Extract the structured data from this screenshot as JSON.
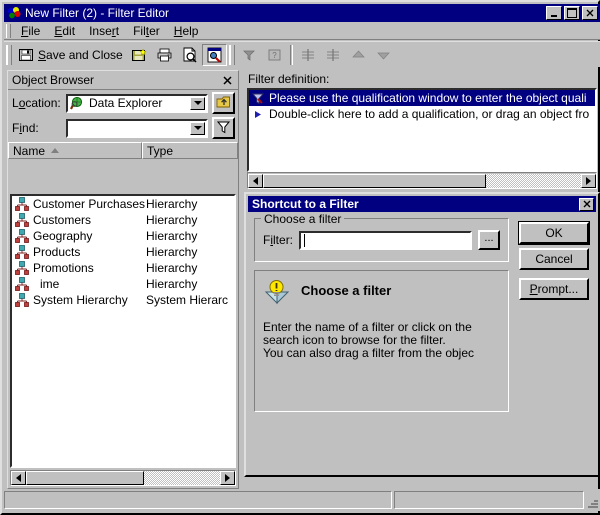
{
  "window": {
    "title": "New Filter (2) - Filter Editor",
    "app_icon": "spheres-icon",
    "minimize_label": "_",
    "maximize_label": "□",
    "close_label": "✕"
  },
  "menu": {
    "items": [
      {
        "label": "File",
        "mnemonic": "F"
      },
      {
        "label": "Edit",
        "mnemonic": "E"
      },
      {
        "label": "Insert",
        "mnemonic": "r"
      },
      {
        "label": "Filter",
        "mnemonic": "t"
      },
      {
        "label": "Help",
        "mnemonic": "H"
      }
    ]
  },
  "toolbar": {
    "save_and_close_label": "Save and Close",
    "buttons": [
      {
        "name": "save-and-close",
        "icon": "floppy-disk-icon",
        "enabled": true
      },
      {
        "name": "save-as",
        "icon": "floppy-disk-star-icon",
        "enabled": true
      },
      {
        "name": "print",
        "icon": "printer-icon",
        "enabled": true
      },
      {
        "name": "print-preview",
        "icon": "document-magnifier-icon",
        "enabled": true
      },
      {
        "name": "find",
        "icon": "window-search-icon",
        "enabled": true,
        "pressed": true
      },
      {
        "name": "insert-shortcut-filter",
        "icon": "filter-shortcut-icon",
        "enabled": false
      },
      {
        "name": "insert-prompt",
        "icon": "prompt-icon",
        "enabled": false
      },
      {
        "name": "insert-qualification",
        "icon": "qualification-icon",
        "enabled": false
      },
      {
        "name": "insert-qualification-2",
        "icon": "qualification-icon",
        "enabled": false
      },
      {
        "name": "move-up",
        "icon": "arrow-up-icon",
        "enabled": false
      },
      {
        "name": "move-down",
        "icon": "arrow-down-icon",
        "enabled": false
      }
    ]
  },
  "object_browser": {
    "title": "Object Browser",
    "close_label": "✕",
    "location_label": "Location:",
    "location_value": "Data Explorer",
    "location_icon": "data-explorer-icon",
    "up_button_icon": "up-one-level-icon",
    "find_label": "Find:",
    "find_value": "",
    "filter_button_icon": "funnel-icon",
    "columns": [
      "Name",
      "Type"
    ],
    "sort_column": "Name",
    "sort_direction": "ascending",
    "items": [
      {
        "name": "Customer Purchases",
        "type": "Hierarchy",
        "icon": "hierarchy-icon"
      },
      {
        "name": "Customers",
        "type": "Hierarchy",
        "icon": "hierarchy-icon"
      },
      {
        "name": "Geography",
        "type": "Hierarchy",
        "icon": "hierarchy-icon"
      },
      {
        "name": "Products",
        "type": "Hierarchy",
        "icon": "hierarchy-icon"
      },
      {
        "name": "Promotions",
        "type": "Hierarchy",
        "icon": "hierarchy-icon"
      },
      {
        "name": "ime",
        "type": "Hierarchy",
        "icon": "hierarchy-icon"
      },
      {
        "name": "System Hierarchy",
        "type": "System Hierarc",
        "icon": "hierarchy-icon"
      }
    ],
    "scroll_left_label": "◀",
    "scroll_right_label": "▶"
  },
  "filter_definition": {
    "label": "Filter definition:",
    "rows": [
      {
        "text": "Please use the qualification window to enter the object quali",
        "icon": "filter-icon",
        "selected": true
      },
      {
        "text": "Double-click here to add a qualification, or drag an object fro",
        "icon": "blue-triangle-bullet-icon",
        "selected": false
      }
    ],
    "scroll_left_label": "◀",
    "scroll_right_label": "▶"
  },
  "dialog": {
    "title": "Shortcut to a Filter",
    "close_label": "✕",
    "group_legend": "Choose a filter",
    "filter_label": "Filter:",
    "filter_value": "",
    "filter_placeholder": "",
    "browse_label": "...",
    "help": {
      "icon": "lightbulb-tip-icon",
      "title": "Choose a filter",
      "lines": [
        "Enter the name of a filter or click on the",
        "search icon to browse for the filter.",
        "You can also drag a filter from the objec"
      ]
    },
    "buttons": {
      "ok": "OK",
      "cancel": "Cancel",
      "prompt": "Prompt..."
    }
  },
  "statusbar": {
    "pane_left": "",
    "pane_right": ""
  }
}
